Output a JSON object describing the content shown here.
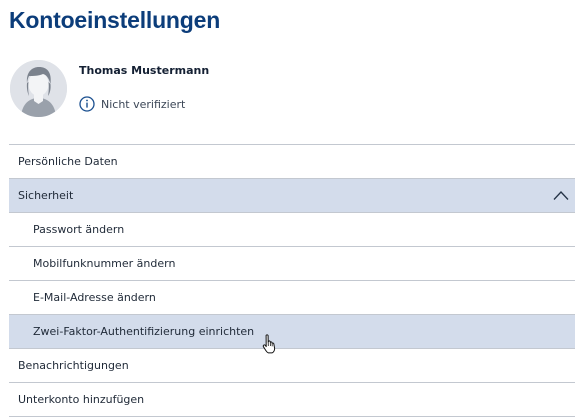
{
  "page": {
    "title": "Kontoeinstellungen"
  },
  "profile": {
    "name": "Thomas Mustermann",
    "verification_status": "Nicht verifiziert",
    "info_icon": "info-circle-icon",
    "avatar_icon": "user-avatar-placeholder"
  },
  "menu": {
    "items": [
      {
        "label": "Persönliche Daten",
        "level": 1,
        "state": "default"
      },
      {
        "label": "Sicherheit",
        "level": 1,
        "state": "expanded",
        "icon": "chevron-up-icon"
      },
      {
        "label": "Passwort ändern",
        "level": 2,
        "state": "default"
      },
      {
        "label": "Mobilfunknummer ändern",
        "level": 2,
        "state": "default"
      },
      {
        "label": "E-Mail-Adresse ändern",
        "level": 2,
        "state": "default"
      },
      {
        "label": "Zwei-Faktor-Authentifizierung einrichten",
        "level": 2,
        "state": "hover"
      },
      {
        "label": "Benachrichtigungen",
        "level": 1,
        "state": "default"
      },
      {
        "label": "Unterkonto hinzufügen",
        "level": 1,
        "state": "default"
      }
    ]
  },
  "colors": {
    "title": "#0c3d7a",
    "active_row_background": "#d3dceb",
    "divider": "#c3c8d0",
    "info_icon": "#1a4f8f"
  },
  "cursor": {
    "icon": "hand-pointer-icon"
  }
}
